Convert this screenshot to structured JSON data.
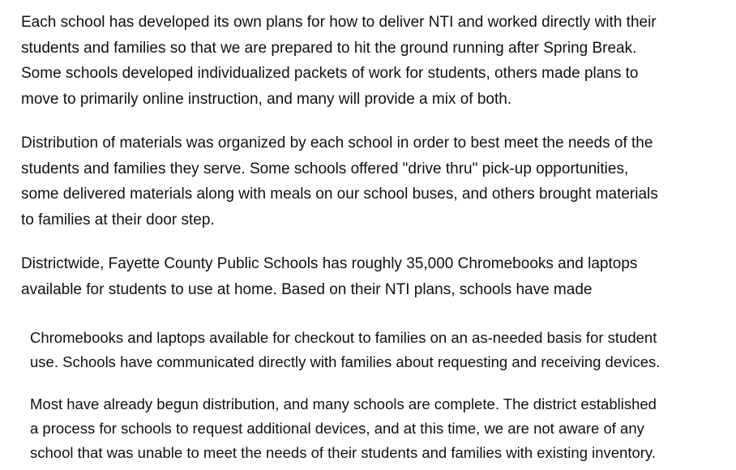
{
  "document": {
    "paragraphs": [
      {
        "lines": [
          "Each school has developed its own plans for how to deliver NTI and worked directly with their",
          "students and families so that we are prepared to hit the ground running after Spring Break.",
          "Some schools developed individualized packets of work for students, others made plans to",
          "move to primarily online instruction, and many will provide a mix of both."
        ]
      },
      {
        "lines": [
          "Distribution of materials was organized by each school in order to best meet the needs of the",
          "students and families they serve. Some schools offered \"drive thru\" pick-up opportunities,",
          "some delivered materials along with meals on our school buses, and others brought materials",
          "to families at their door step."
        ]
      },
      {
        "lines": [
          "Districtwide, Fayette County Public Schools has roughly 35,000 Chromebooks and laptops",
          "available for students to use at home. Based on their NTI plans, schools have made"
        ]
      },
      {
        "lines": [
          "Chromebooks and laptops available for checkout to families on an as-needed basis for student",
          "use. Schools have communicated directly with families about requesting and receiving devices."
        ]
      },
      {
        "lines": [
          "Most have already begun distribution, and many schools are complete. The district established",
          "a process for schools to request additional devices, and at this time, we are not aware of any",
          "school that was unable to meet the needs of their students and families with existing inventory."
        ]
      }
    ]
  }
}
